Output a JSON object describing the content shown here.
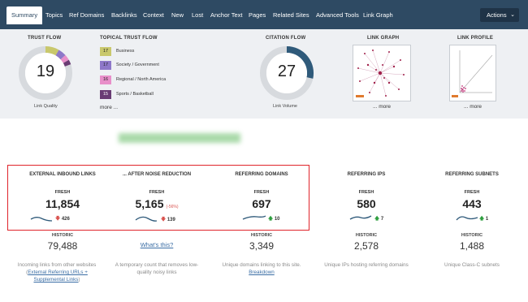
{
  "nav": {
    "tabs": [
      "Summary",
      "Topics",
      "Ref Domains",
      "Backlinks",
      "Context",
      "New",
      "Lost",
      "Anchor Text",
      "Pages",
      "Related Sites",
      "Advanced Tools",
      "Link Graph"
    ],
    "actions_label": "Actions"
  },
  "summary": {
    "trust_flow": {
      "title": "TRUST FLOW",
      "value": "19",
      "caption": "Link Quality"
    },
    "topical": {
      "title": "TOPICAL TRUST FLOW",
      "items": [
        {
          "num": "17",
          "name": "Business",
          "color": "#c9c86c"
        },
        {
          "num": "17",
          "name": "Society / Government",
          "color": "#8e78c9"
        },
        {
          "num": "16",
          "name": "Regional / North America",
          "color": "#e88fc9"
        },
        {
          "num": "15",
          "name": "Sports / Basketball",
          "color": "#6a3c74"
        }
      ],
      "more": "more ..."
    },
    "citation_flow": {
      "title": "CITATION FLOW",
      "value": "27",
      "caption": "Link Volume"
    },
    "link_graph": {
      "title": "LINK GRAPH",
      "more": "... more"
    },
    "link_profile": {
      "title": "LINK PROFILE",
      "more": "... more"
    }
  },
  "stats": [
    {
      "title": "EXTERNAL INBOUND LINKS",
      "fresh_label": "FRESH",
      "fresh": "11,854",
      "pct": "",
      "delta": "426",
      "dir": "down",
      "hist_label": "HISTORIC",
      "hist": "79,488",
      "desc": "Incoming links from other websites (",
      "desc_link": "External Referring URLs + Supplemental Links",
      "desc_end": ")"
    },
    {
      "title": "... AFTER NOISE REDUCTION",
      "fresh_label": "FRESH",
      "fresh": "5,165",
      "pct": "(-56%)",
      "delta": "139",
      "dir": "down",
      "hist_label": "",
      "hist": "",
      "link": "What's this?",
      "desc": "A temporary count that removes low-quality noisy links",
      "desc_link": "",
      "desc_end": ""
    },
    {
      "title": "REFERRING DOMAINS",
      "fresh_label": "FRESH",
      "fresh": "697",
      "pct": "",
      "delta": "10",
      "dir": "up",
      "hist_label": "HISTORIC",
      "hist": "3,349",
      "desc": "Unique domains linking to this site. ",
      "desc_link": "Breakdown",
      "desc_end": ""
    },
    {
      "title": "REFERRING IPS",
      "fresh_label": "FRESH",
      "fresh": "580",
      "pct": "",
      "delta": "7",
      "dir": "up",
      "hist_label": "HISTORIC",
      "hist": "2,578",
      "desc": "Unique IPs hosting referring domains",
      "desc_link": "",
      "desc_end": ""
    },
    {
      "title": "REFERRING SUBNETS",
      "fresh_label": "FRESH",
      "fresh": "443",
      "pct": "",
      "delta": "1",
      "dir": "up",
      "hist_label": "HISTORIC",
      "hist": "1,488",
      "desc": "Unique Class-C subnets",
      "desc_link": "",
      "desc_end": ""
    }
  ]
}
